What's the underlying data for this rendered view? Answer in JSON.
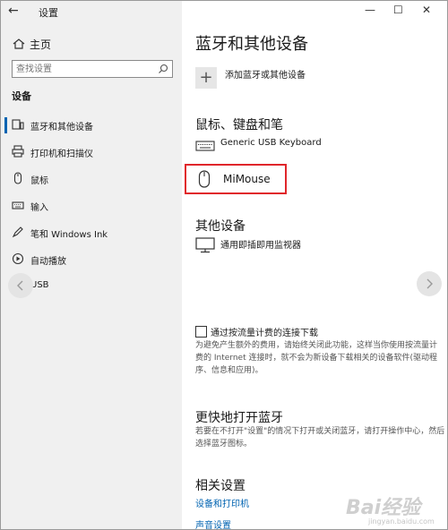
{
  "window": {
    "title": "设置",
    "back_glyph": "←",
    "minimize_glyph": "—",
    "maximize_glyph": "☐",
    "close_glyph": "✕"
  },
  "sidebar": {
    "home_label": "主页",
    "search_placeholder": "查找设置",
    "section_title": "设备",
    "items": [
      {
        "label": "蓝牙和其他设备",
        "icon": "bluetooth-devices-icon",
        "selected": true
      },
      {
        "label": "打印机和扫描仪",
        "icon": "printer-icon",
        "selected": false
      },
      {
        "label": "鼠标",
        "icon": "mouse-icon",
        "selected": false
      },
      {
        "label": "输入",
        "icon": "keyboard-icon",
        "selected": false
      },
      {
        "label": "笔和 Windows Ink",
        "icon": "pen-icon",
        "selected": false
      },
      {
        "label": "自动播放",
        "icon": "autoplay-icon",
        "selected": false
      },
      {
        "label": "USB",
        "icon": "usb-icon",
        "selected": false
      }
    ]
  },
  "main": {
    "title": "蓝牙和其他设备",
    "add_device_label": "添加蓝牙或其他设备",
    "mouse_keyboard_pen": {
      "heading": "鼠标、键盘和笔",
      "devices": [
        {
          "name": "Generic USB Keyboard",
          "icon": "keyboard-icon"
        },
        {
          "name": "MiMouse",
          "icon": "mouse-icon",
          "highlighted": true
        }
      ]
    },
    "other_devices": {
      "heading": "其他设备",
      "devices": [
        {
          "name": "通用即插即用监视器",
          "icon": "monitor-icon"
        }
      ]
    },
    "metered": {
      "checkbox_label": "通过按流量计费的连接下载",
      "checked": false,
      "description_lines": [
        "为避免产生额外的费用，请始终关闭此功能，这样当你使用按流量计",
        "费的 Internet 连接时，就不会为新设备下载相关的设备软件(驱动程",
        "序、信息和应用)。"
      ]
    },
    "quick_bluetooth": {
      "heading": "更快地打开蓝牙",
      "description_lines": [
        "若要在不打开\"设置\"的情况下打开或关闭蓝牙，请打开操作中心，然后",
        "选择蓝牙图标。"
      ]
    },
    "related": {
      "heading": "相关设置",
      "links": [
        "设备和打印机",
        "声音设置"
      ]
    }
  },
  "watermark": {
    "brand": "Bai经验",
    "url": "jingyan.baidu.com"
  },
  "colors": {
    "accent": "#0063b1",
    "highlight_border": "#e0262b",
    "sidebar_bg": "#f0f0f0"
  }
}
